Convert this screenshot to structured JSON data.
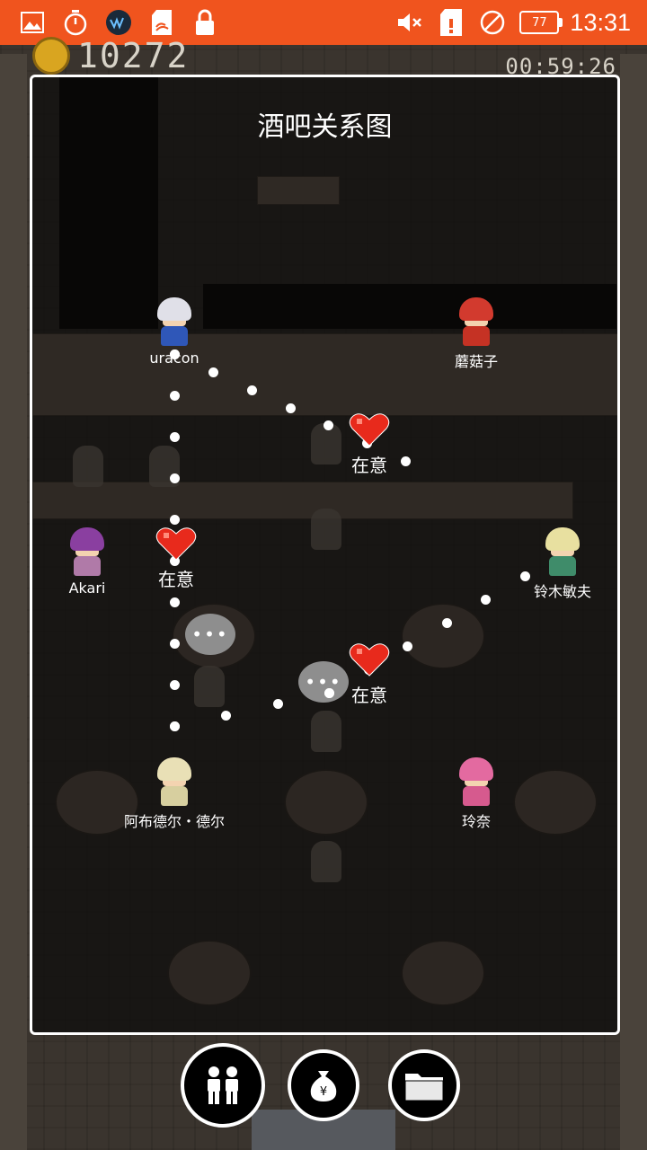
{
  "status_bar": {
    "time": "13:31",
    "battery": "77",
    "bg_color": "#f0541e",
    "left_icons": [
      "image-icon",
      "timer-icon",
      "app-icon",
      "sd-card-icon",
      "lock-icon"
    ],
    "right_icons": [
      "mute-icon",
      "sim-alert-icon",
      "no-signal-icon",
      "battery-icon"
    ]
  },
  "hud": {
    "gold": "10272",
    "time": "00:59:26"
  },
  "panel": {
    "title": "酒吧关系图"
  },
  "characters": [
    {
      "id": "uracon",
      "name": "uracon",
      "hair": "#e0e0e8",
      "body": "#2f57b8"
    },
    {
      "id": "mogu",
      "name": "蘑菇子",
      "hair": "#d23a2e",
      "body": "#c53224"
    },
    {
      "id": "akari",
      "name": "Akari",
      "hair": "#8a3fa0",
      "body": "#b07aa8"
    },
    {
      "id": "suzuki",
      "name": "铃木敏夫",
      "hair": "#e8e0a0",
      "body": "#3f8c6a"
    },
    {
      "id": "abdul",
      "name": "阿布德尔・德尔",
      "hair": "#e9e0b6",
      "body": "#d7cf9f"
    },
    {
      "id": "reina",
      "name": "玲奈",
      "hair": "#e36aa0",
      "body": "#d65a8e"
    }
  ],
  "relations": [
    {
      "label": "在意"
    },
    {
      "label": "在意"
    },
    {
      "label": "在意"
    }
  ],
  "bubbles": [
    "•••",
    "•••"
  ],
  "bottom_buttons": [
    {
      "icon": "people-icon"
    },
    {
      "icon": "money-bag-icon"
    },
    {
      "icon": "folder-icon"
    }
  ]
}
